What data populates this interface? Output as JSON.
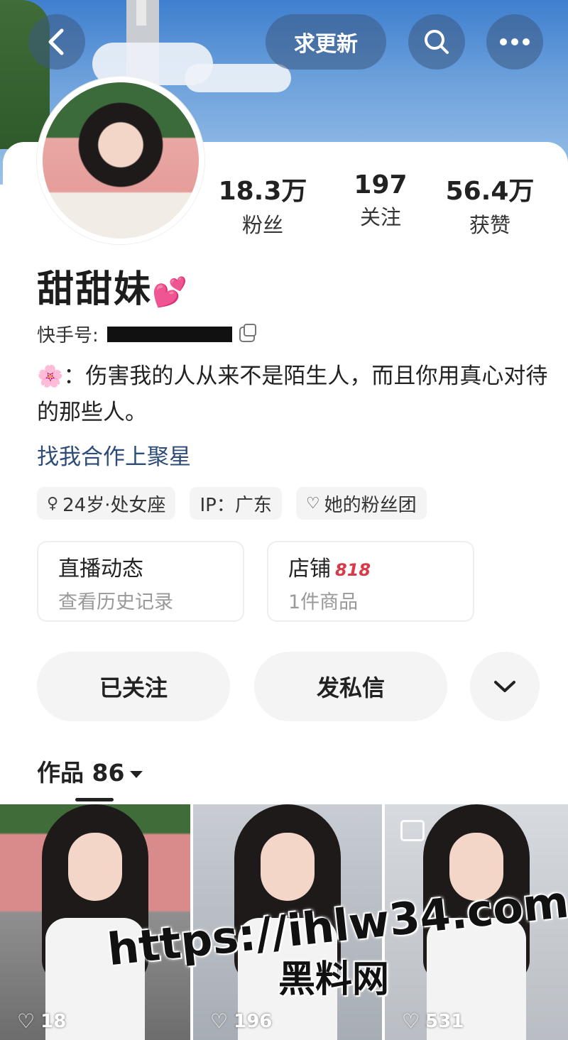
{
  "header": {
    "update_label": "求更新",
    "back_icon": "chevron-left-icon",
    "search_icon": "search-icon",
    "more_icon": "more-icon"
  },
  "profile": {
    "name": "甜甜妹",
    "name_emoji": "💕",
    "id_label": "快手号:",
    "bio_emoji": "🌸",
    "bio": "：伤害我的人从来不是陌生人，而且你用真心对待的那些人。",
    "link": "找我合作上聚星",
    "stats": [
      {
        "value": "18.3万",
        "label": "粉丝"
      },
      {
        "value": "197",
        "label": "关注"
      },
      {
        "value": "56.4万",
        "label": "获赞"
      }
    ],
    "tags": [
      {
        "icon": "♀",
        "text": "24岁·处女座"
      },
      {
        "icon": "",
        "text": "IP：广东"
      },
      {
        "icon": "♡",
        "text": "她的粉丝团"
      }
    ]
  },
  "entries": {
    "live": {
      "title": "直播动态",
      "sub": "查看历史记录"
    },
    "shop": {
      "title": "店铺",
      "badge": "818",
      "sub": "1件商品"
    }
  },
  "actions": {
    "follow": "已关注",
    "message": "发私信",
    "more_icon": "chevron-down-icon"
  },
  "works": {
    "label": "作品 86",
    "items": [
      {
        "likes": "18"
      },
      {
        "likes": "196"
      },
      {
        "likes": "531"
      }
    ]
  },
  "watermark": {
    "url": "https://ihlw34.com",
    "text": "黑料网"
  },
  "colors": {
    "accent_link": "#2d4d78",
    "badge_red": "#d83a4a",
    "pink_heart": "#e45aa8"
  }
}
